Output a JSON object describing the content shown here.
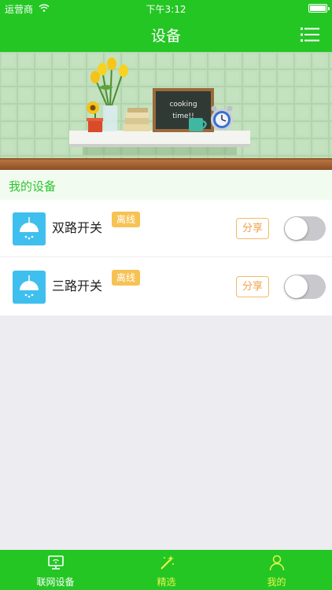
{
  "status_bar": {
    "carrier": "运营商",
    "time": "下午3:12"
  },
  "nav": {
    "title": "设备",
    "menu_icon": "list-icon"
  },
  "banner": {
    "sign_text_line1": "cooking",
    "sign_text_line2": "time!!"
  },
  "section": {
    "title": "我的设备"
  },
  "devices": [
    {
      "name": "双路开关",
      "badge": "离线",
      "share": "分享",
      "on": false,
      "icon": "lamp-icon"
    },
    {
      "name": "三路开关",
      "badge": "离线",
      "share": "分享",
      "on": false,
      "icon": "lamp-icon"
    }
  ],
  "tabs": [
    {
      "label": "联网设备",
      "icon": "monitor-icon"
    },
    {
      "label": "精选",
      "icon": "magic-wand-icon"
    },
    {
      "label": "我的",
      "icon": "person-icon"
    }
  ],
  "colors": {
    "brand_green": "#24c624",
    "badge": "#f6c253",
    "share": "#f0a04a",
    "tab_active_text": "#e8f54a"
  }
}
